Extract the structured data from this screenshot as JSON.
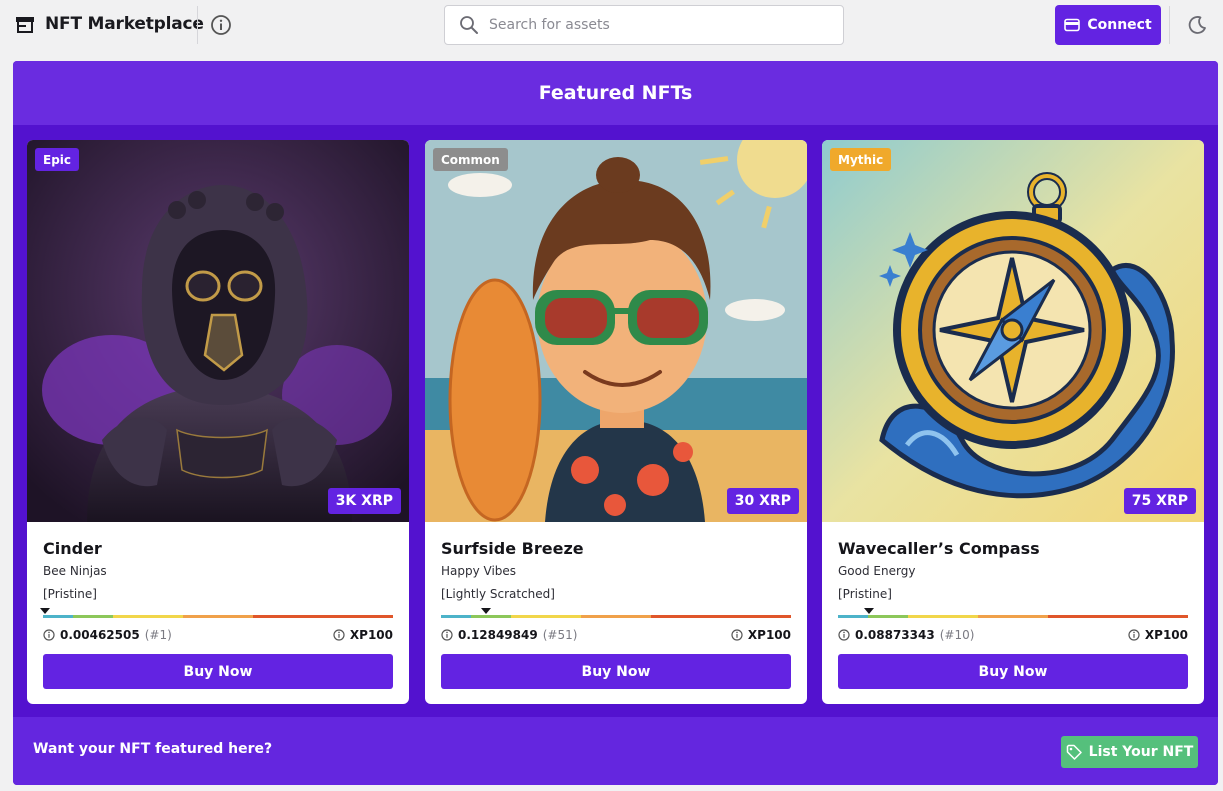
{
  "header": {
    "app_title": "NFT Marketplace",
    "search_placeholder": "Search for assets",
    "connect_label": "Connect"
  },
  "featured": {
    "title": "Featured NFTs",
    "cards": [
      {
        "rarity": "Epic",
        "rarity_color": "#6323e2",
        "price": "3K XRP",
        "name": "Cinder",
        "collection": "Bee Ninjas",
        "condition": "[Pristine]",
        "serial": "0.00462505",
        "rank": "(#1)",
        "xp": "XP100",
        "buy_label": "Buy Now"
      },
      {
        "rarity": "Common",
        "rarity_color": "#8d8d8d",
        "price": "30 XRP",
        "name": "Surfside Breeze",
        "collection": "Happy Vibes",
        "condition": "[Lightly Scratched]",
        "serial": "0.12849849",
        "rank": "(#51)",
        "xp": "XP100",
        "buy_label": "Buy Now"
      },
      {
        "rarity": "Mythic",
        "rarity_color": "#f0a92b",
        "price": "75 XRP",
        "name": "Wavecaller’s Compass",
        "collection": "Good Energy",
        "condition": "[Pristine]",
        "serial": "0.08873343",
        "rank": "(#10)",
        "xp": "XP100",
        "buy_label": "Buy Now"
      }
    ]
  },
  "footer": {
    "prompt": "Want your NFT featured here?",
    "list_label": "List Your NFT"
  },
  "colors": {
    "accent": "#6323e2",
    "panel": "#5b17d8",
    "list_button": "#55c07c",
    "condition_bar": [
      "#4db3c9",
      "#8cc75a",
      "#f1d64a",
      "#f0a14a",
      "#e0562a"
    ]
  },
  "icons": [
    "store-icon",
    "info-icon",
    "search-icon",
    "wallet-icon",
    "moon-icon",
    "tag-icon"
  ]
}
